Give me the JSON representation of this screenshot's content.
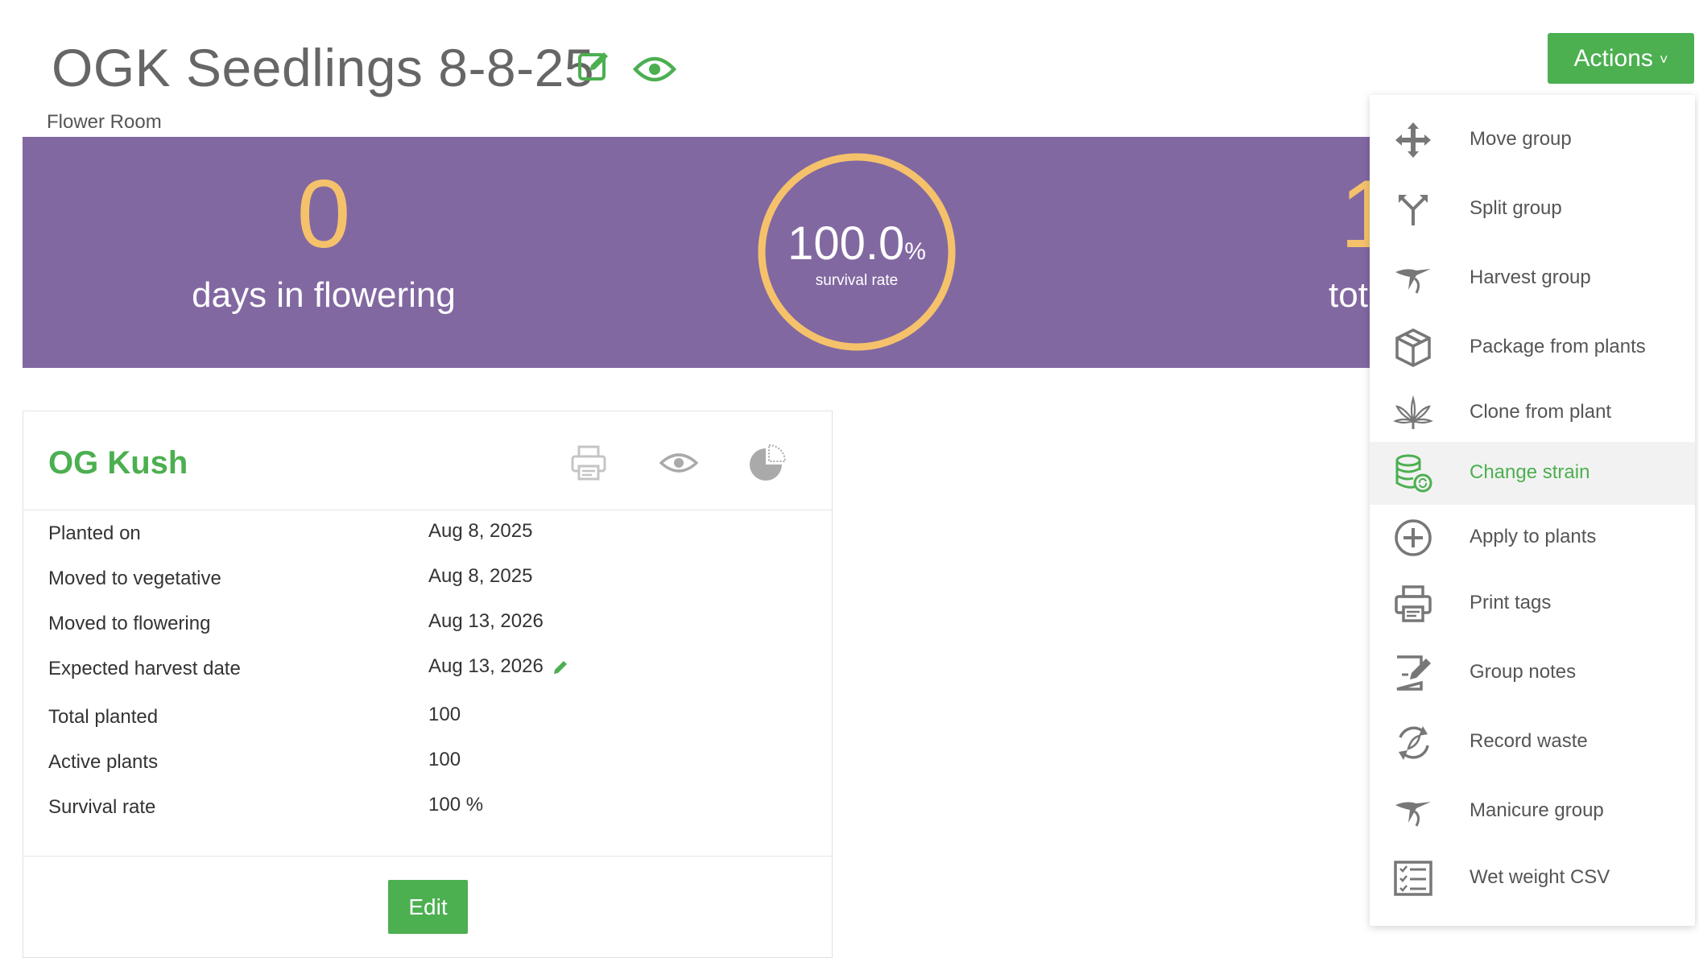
{
  "header": {
    "title": "OGK Seedlings 8-8-25",
    "subtitle": "Flower Room",
    "actions_label": "Actions",
    "actions_chevron": "˅"
  },
  "banner": {
    "days_value": "0",
    "days_label": "days in flowering",
    "survival_value": "100.0",
    "survival_unit": "%",
    "survival_label": "survival rate",
    "survival_fraction": 1.0,
    "right_value_partial": "1",
    "right_label_partial": "tot"
  },
  "card": {
    "strain": "OG Kush",
    "rows": [
      {
        "label": "Planted on",
        "value": "Aug 8, 2025"
      },
      {
        "label": "Moved to vegetative",
        "value": "Aug 8, 2025"
      },
      {
        "label": "Moved to flowering",
        "value": "Aug 13, 2026"
      },
      {
        "label": "Expected harvest date",
        "value": "Aug 13, 2026"
      },
      {
        "label": "Total planted",
        "value": "100"
      },
      {
        "label": "Active plants",
        "value": "100"
      },
      {
        "label": "Survival rate",
        "value": "100 %"
      }
    ],
    "edit_label": "Edit"
  },
  "menu": {
    "items": [
      {
        "label": "Move group",
        "icon": "move-icon"
      },
      {
        "label": "Split group",
        "icon": "split-icon"
      },
      {
        "label": "Harvest group",
        "icon": "harvest-icon"
      },
      {
        "label": "Package from plants",
        "icon": "package-icon"
      },
      {
        "label": "Clone from plant",
        "icon": "cannabis-leaf-icon"
      },
      {
        "label": "Change strain",
        "icon": "change-strain-icon",
        "active": true
      },
      {
        "label": "Apply to plants",
        "icon": "plus-circle-icon"
      },
      {
        "label": "Print tags",
        "icon": "printer-icon"
      },
      {
        "label": "Group notes",
        "icon": "notes-icon"
      },
      {
        "label": "Record waste",
        "icon": "recycle-icon"
      },
      {
        "label": "Manicure group",
        "icon": "manicure-icon"
      },
      {
        "label": "Wet weight CSV",
        "icon": "checklist-icon"
      }
    ]
  },
  "colors": {
    "brand_green": "#4caf50",
    "banner_purple": "#8268a1",
    "accent_gold": "#f5c26b",
    "icon_gray": "#777777"
  }
}
